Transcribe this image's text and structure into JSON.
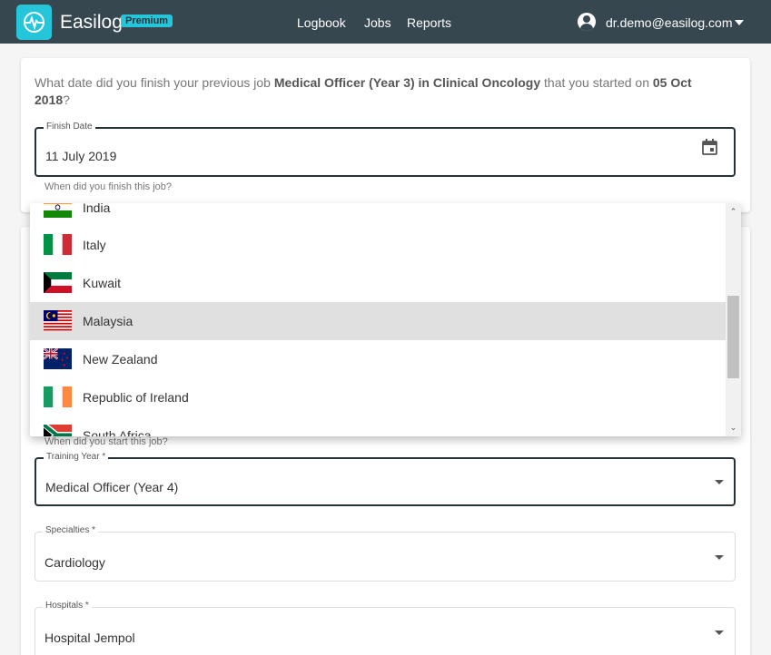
{
  "brand": {
    "name": "Easilog",
    "badge": "Premium"
  },
  "nav": {
    "logbook": "Logbook",
    "jobs": "Jobs",
    "reports": "Reports"
  },
  "user": {
    "email": "dr.demo@easilog.com"
  },
  "question": {
    "prefix": "What date did you finish your previous job ",
    "job": "Medical Officer (Year 3) in Clinical Oncology",
    "middle": " that you started on ",
    "date": "05 Oct 2018",
    "suffix": "?"
  },
  "finish_date": {
    "label": "Finish Date",
    "value": "11 July 2019",
    "helper": "When did you finish this job?"
  },
  "countries": [
    {
      "name": "India",
      "flag": "india-flag"
    },
    {
      "name": "Italy",
      "flag": "italy-flag"
    },
    {
      "name": "Kuwait",
      "flag": "kuwait-flag"
    },
    {
      "name": "Malaysia",
      "flag": "malaysia-flag",
      "selected": true
    },
    {
      "name": "New Zealand",
      "flag": "new-zealand-flag"
    },
    {
      "name": "Republic of Ireland",
      "flag": "ireland-flag"
    },
    {
      "name": "South Africa",
      "flag": "south-africa-flag"
    }
  ],
  "start_helper": "When did you start this job?",
  "training_year": {
    "label": "Training Year *",
    "value": "Medical Officer (Year 4)"
  },
  "specialties": {
    "label": "Specialties *",
    "value": "Cardiology"
  },
  "hospitals": {
    "label": "Hospitals *",
    "value": "Hospital Jempol"
  },
  "colors": {
    "topbar": "#37474f",
    "accent": "#26c6da"
  }
}
